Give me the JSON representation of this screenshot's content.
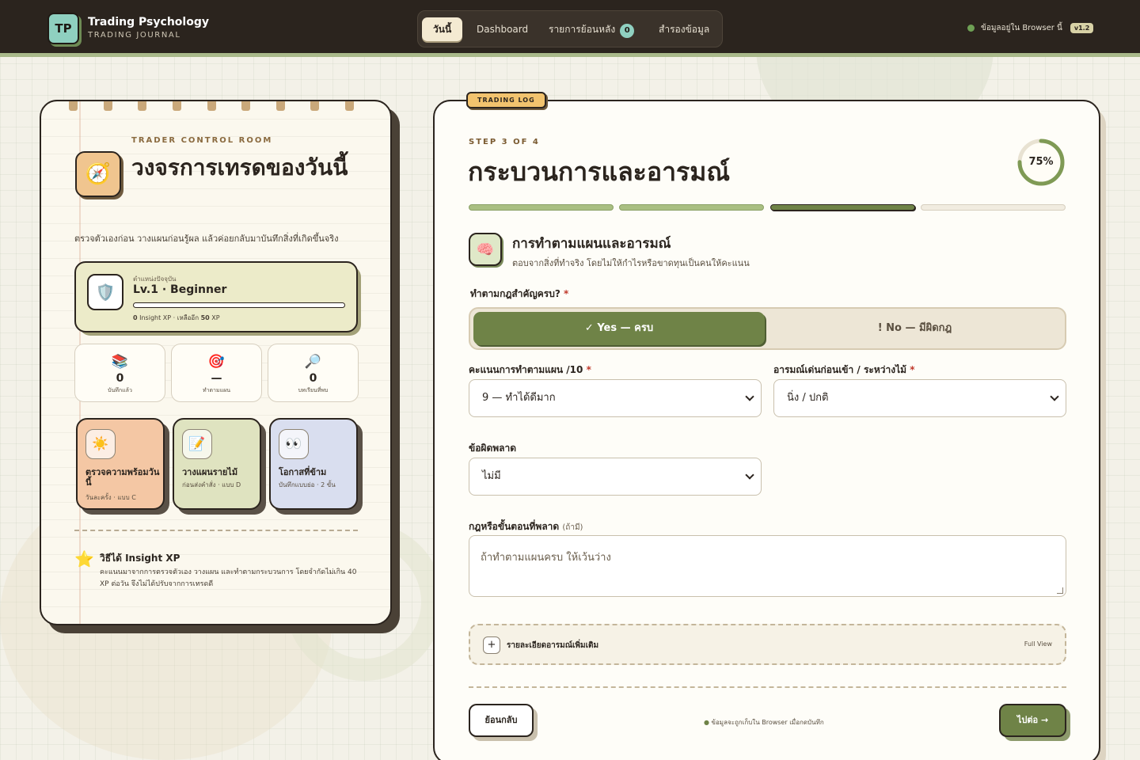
{
  "header": {
    "logo_text": "TP",
    "brand_title": "Trading Psychology",
    "brand_sub": "TRADING JOURNAL",
    "nav": [
      {
        "label": "วันนี้",
        "active": true
      },
      {
        "label": "Dashboard",
        "active": false
      },
      {
        "label": "รายการย้อนหลัง",
        "active": false,
        "badge": "0"
      },
      {
        "label": "สำรองข้อมูล",
        "active": false
      }
    ],
    "status_text": "ข้อมูลอยู่ใน Browser นี้",
    "version": "v1.2"
  },
  "left": {
    "eyebrow": "TRADER CONTROL ROOM",
    "compass_icon": "compass-icon",
    "title": "วงจรการเทรดของวันนี้",
    "desc": "ตรวจตัวเองก่อน วางแผนก่อนรู้ผล แล้วค่อยกลับมาบันทึกสิ่งที่เกิดขึ้นจริง",
    "level": {
      "caption": "ตำแหน่งปัจจุบัน",
      "name": "Lv.1 · Beginner",
      "progress": 0,
      "xp_current": "0",
      "xp_text_1": " Insight XP · เหลืออีก ",
      "xp_remaining": "50",
      "xp_text_2": " XP"
    },
    "stats": [
      {
        "icon": "books-icon",
        "glyph": "📚",
        "value": "0",
        "label": "บันทึกแล้ว"
      },
      {
        "icon": "target-icon",
        "glyph": "🎯",
        "value": "—",
        "label": "ทำตามแผน"
      },
      {
        "icon": "magnifier-icon",
        "glyph": "🔎",
        "value": "0",
        "label": "บทเรียนที่พบ"
      }
    ],
    "tiles": [
      {
        "icon": "sun-icon",
        "glyph": "☀️",
        "title": "ตรวจความพร้อมวันนี้",
        "sub": "วันละครั้ง · แบบ C",
        "color": "#f4c7a4"
      },
      {
        "icon": "memo-icon",
        "glyph": "📝",
        "title": "วางแผนรายไม้",
        "sub": "ก่อนส่งคำสั่ง · แบบ D",
        "color": "#dfe3c0"
      },
      {
        "icon": "eyes-icon",
        "glyph": "👀",
        "title": "โอกาสที่ข้าม",
        "sub": "บันทึกแบบย่อ · 2 ขั้น",
        "color": "#d9deef"
      }
    ],
    "insight_title": "วิธีได้ Insight XP",
    "insight_desc": "คะแนนมาจากการตรวจตัวเอง วางแผน และทำตามกระบวนการ โดยจำกัดไม่เกิน 40 XP ต่อวัน จึงไม่ได้ปรับจากการเทรดดี"
  },
  "form": {
    "tag": "TRADING LOG",
    "step": "STEP 3 OF 4",
    "title": "กระบวนการและอารมณ์",
    "percent": "75%",
    "progress_fraction": 0.75,
    "steps_state": [
      "done",
      "done",
      "current",
      "todo"
    ],
    "section_icon": "brain-icon",
    "section_title": "การทำตามแผนและอารมณ์",
    "section_desc": "ตอบจากสิ่งที่ทำจริง โดยไม่ให้กำไรหรือขาดทุนเป็นคนให้คะแนน",
    "rules_label": "ทำตามกฎสำคัญครบ?",
    "rules_yes": "✓ Yes — ครบ",
    "rules_no": "! No — มีผิดกฎ",
    "score_label": "คะแนนการทำตามแผน /10",
    "score_value": "9 — ทำได้ดีมาก",
    "emotion_label": "อารมณ์เด่นก่อนเข้า / ระหว่างไม้",
    "emotion_value": "นิ่ง / ปกติ",
    "mistake_label": "ข้อผิดพลาด",
    "mistake_value": "ไม่มี",
    "rule_missed_label": "กฎหรือขั้นตอนที่พลาด",
    "rule_missed_optional": "(ถ้ามี)",
    "rule_missed_placeholder": "ถ้าทำตามแผนครบ ให้เว้นว่าง",
    "required_mark": "*",
    "details_title": "รายละเอียดอารมณ์เพิ่มเติม",
    "details_right": "Full View",
    "back_label": "ย้อนกลับ",
    "footer_note": "ข้อมูลจะถูกเก็บใน Browser เมื่อกดบันทึก",
    "next_label": "ไปต่อ →"
  },
  "colors": {
    "accent": "#6f8347",
    "topbar": "#2b241e",
    "teal": "#8fd0c0"
  }
}
